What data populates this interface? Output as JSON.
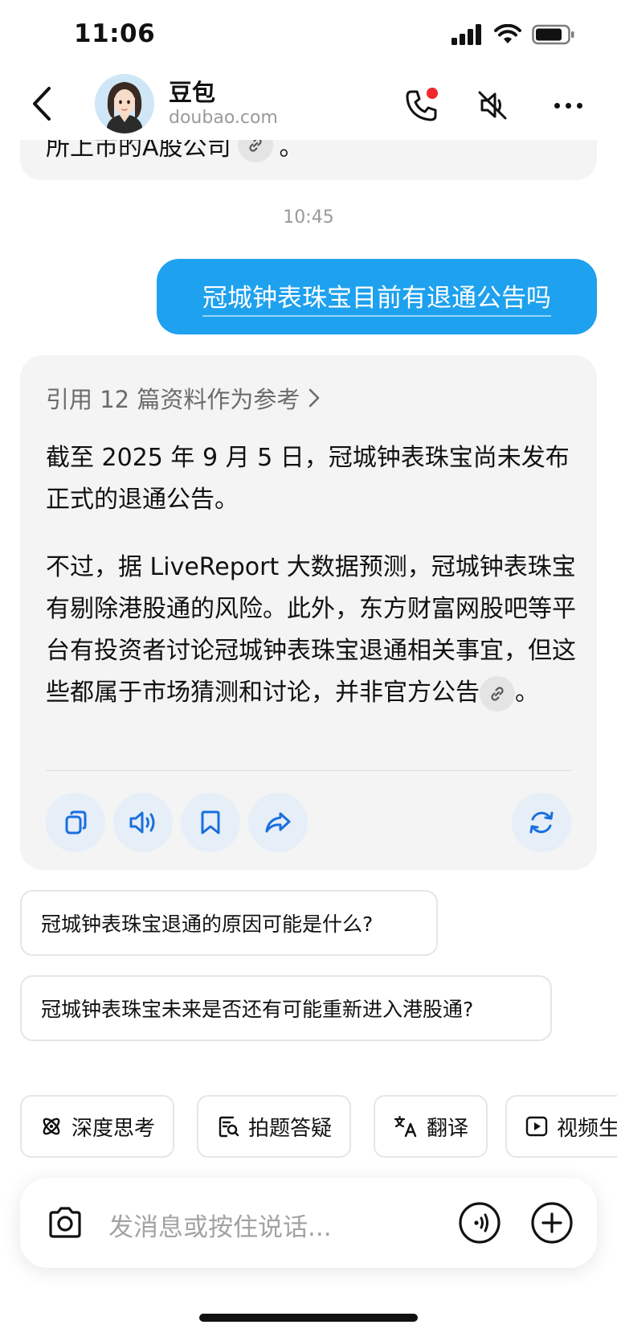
{
  "status_bar": {
    "time": "11:06"
  },
  "header": {
    "name": "豆包",
    "domain": "doubao.com"
  },
  "previous_message": {
    "text": "所上市的A股公司",
    "suffix": "。"
  },
  "timestamp": "10:45",
  "user_message": "冠城钟表珠宝目前有退通公告吗",
  "answer": {
    "references": "引用 12 篇资料作为参考",
    "paragraph1": "截至 2025 年 9 月 5 日，冠城钟表珠宝尚未发布正式的退通公告。",
    "paragraph2": "不过，据 LiveReport 大数据预测，冠城钟表珠宝有剔除港股通的风险。此外，东方财富网股吧等平台有投资者讨论冠城钟表珠宝退通相关事宜，但这些都属于市场猜测和讨论，并非官方公告",
    "paragraph2_end": "。"
  },
  "suggestions": [
    "冠城钟表珠宝退通的原因可能是什么?",
    "冠城钟表珠宝未来是否还有可能重新进入港股通?"
  ],
  "quick_actions": [
    {
      "label": "深度思考",
      "icon": "atom-icon"
    },
    {
      "label": "拍题答疑",
      "icon": "photo-question-icon"
    },
    {
      "label": "翻译",
      "icon": "translate-icon"
    },
    {
      "label": "视频生",
      "icon": "video-play-icon"
    }
  ],
  "input": {
    "placeholder": "发消息或按住说话..."
  },
  "colors": {
    "accent": "#1ea1ee",
    "action_blue": "#1a6fdf",
    "notification_red": "#f0282d"
  }
}
